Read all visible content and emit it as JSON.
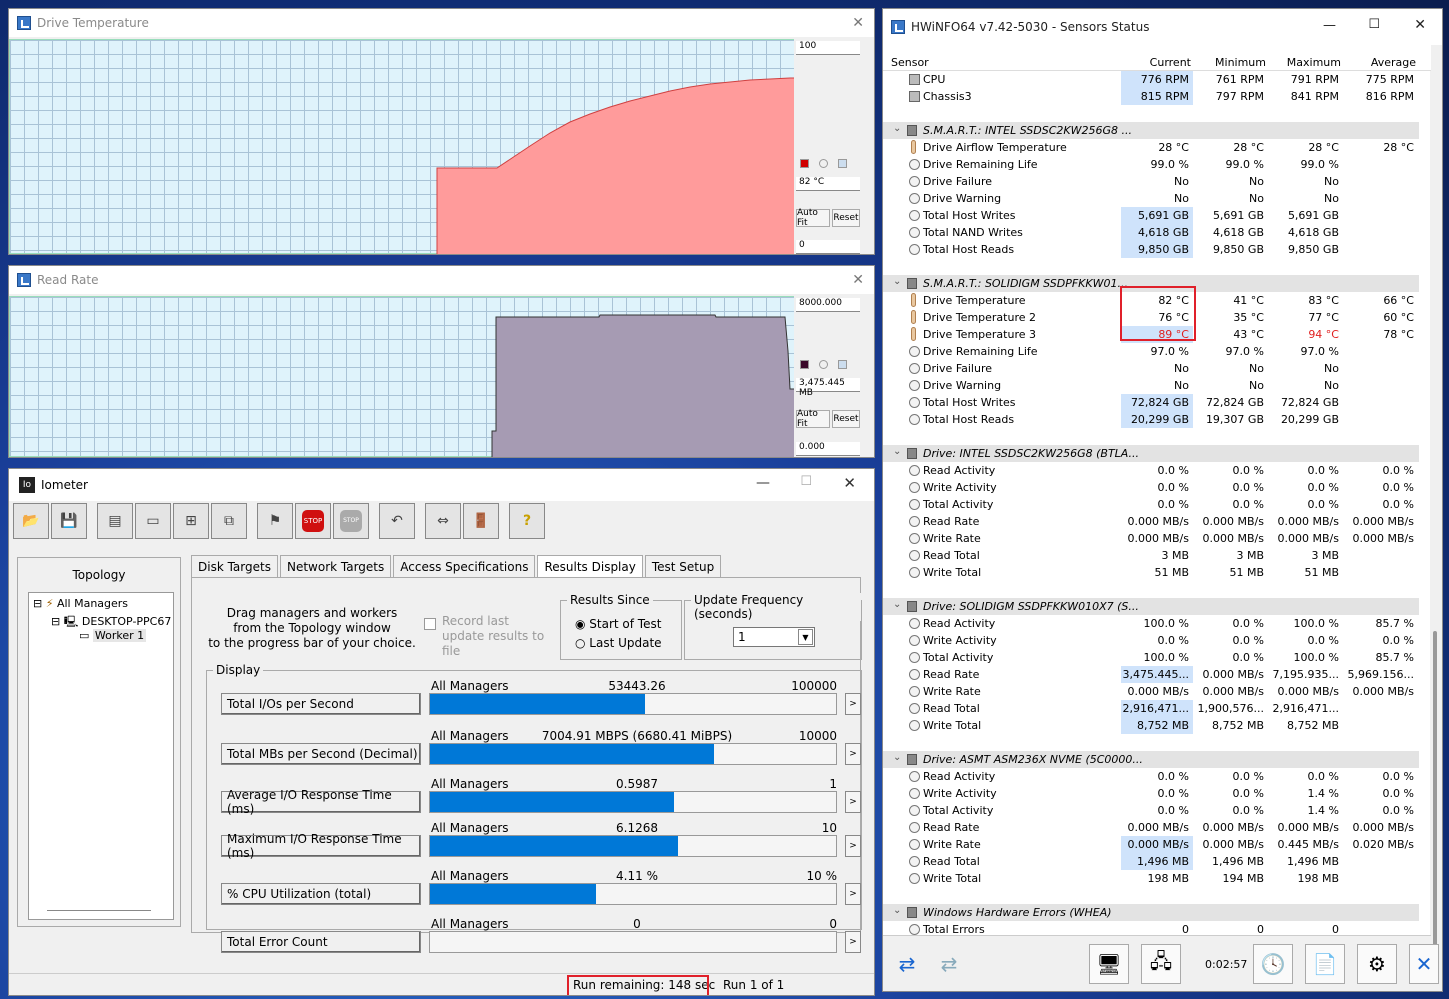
{
  "drive_temp": {
    "title": "Drive Temperature",
    "max": "100",
    "current": "82 °C",
    "min": "0",
    "autofit": "Auto Fit",
    "reset": "Reset",
    "fill_color": "#ff9b9b"
  },
  "read_rate": {
    "title": "Read Rate",
    "max": "8000.000",
    "current": "3,475.445 MB",
    "min": "0.000",
    "autofit": "Auto Fit",
    "reset": "Reset",
    "fill_color": "#a69bb3"
  },
  "iometer": {
    "title": "Iometer",
    "topology_label": "Topology",
    "tree": [
      "All Managers",
      "DESKTOP-PPC67",
      "Worker 1"
    ],
    "tabs": [
      "Disk Targets",
      "Network Targets",
      "Access Specifications",
      "Results Display",
      "Test Setup"
    ],
    "drag_text": [
      "Drag managers and workers",
      "from the Topology window",
      "to the progress bar of your choice."
    ],
    "record_label": "Record last update results to file",
    "results_since": {
      "label": "Results Since",
      "opt1": "Start of Test",
      "opt2": "Last Update"
    },
    "update_freq": {
      "label": "Update Frequency (seconds)",
      "value": "1"
    },
    "display_label": "Display",
    "metrics": [
      {
        "label": "Total I/Os per Second",
        "scope": "All Managers",
        "value": "53443.26",
        "max": "100000",
        "fraction": 0.53
      },
      {
        "label": "Total MBs per Second (Decimal)",
        "scope": "All Managers",
        "value": "7004.91 MBPS (6680.41 MiBPS)",
        "max": "10000",
        "fraction": 0.7
      },
      {
        "label": "Average I/O Response Time (ms)",
        "scope": "All Managers",
        "value": "0.5987",
        "max": "1",
        "fraction": 0.6
      },
      {
        "label": "Maximum I/O Response Time (ms)",
        "scope": "All Managers",
        "value": "6.1268",
        "max": "10",
        "fraction": 0.61
      },
      {
        "label": "% CPU Utilization (total)",
        "scope": "All Managers",
        "value": "4.11 %",
        "max": "10 %",
        "fraction": 0.41
      },
      {
        "label": "Total Error Count",
        "scope": "All Managers",
        "value": "0",
        "max": "0",
        "fraction": 0
      }
    ],
    "status_run_remaining": "Run remaining: 148 sec",
    "status_run": "Run 1 of 1"
  },
  "hwinfo": {
    "title": "HWiNFO64 v7.42-5030 - Sensors Status",
    "headers": [
      "Sensor",
      "Current",
      "Minimum",
      "Maximum",
      "Average"
    ],
    "rows": [
      {
        "t": "fan",
        "n": "CPU",
        "c": [
          "776 RPM",
          "761 RPM",
          "791 RPM",
          "775 RPM"
        ],
        "hl": true
      },
      {
        "t": "fan",
        "n": "Chassis3",
        "c": [
          "815 RPM",
          "797 RPM",
          "841 RPM",
          "816 RPM"
        ],
        "hl": true
      },
      {
        "t": "blank"
      },
      {
        "t": "group",
        "n": "S.M.A.R.T.: INTEL SSDSC2KW256G8 ..."
      },
      {
        "t": "temp",
        "n": "Drive Airflow Temperature",
        "c": [
          "28 °C",
          "28 °C",
          "28 °C",
          "28 °C"
        ]
      },
      {
        "t": "s",
        "n": "Drive Remaining Life",
        "c": [
          "99.0 %",
          "99.0 %",
          "99.0 %",
          ""
        ]
      },
      {
        "t": "s",
        "n": "Drive Failure",
        "c": [
          "No",
          "No",
          "No",
          ""
        ]
      },
      {
        "t": "s",
        "n": "Drive Warning",
        "c": [
          "No",
          "No",
          "No",
          ""
        ]
      },
      {
        "t": "s",
        "n": "Total Host Writes",
        "c": [
          "5,691 GB",
          "5,691 GB",
          "5,691 GB",
          ""
        ],
        "hl": true
      },
      {
        "t": "s",
        "n": "Total NAND Writes",
        "c": [
          "4,618 GB",
          "4,618 GB",
          "4,618 GB",
          ""
        ],
        "hl": true
      },
      {
        "t": "s",
        "n": "Total Host Reads",
        "c": [
          "9,850 GB",
          "9,850 GB",
          "9,850 GB",
          ""
        ],
        "hl": true
      },
      {
        "t": "blank"
      },
      {
        "t": "group",
        "n": "S.M.A.R.T.: SOLIDIGM SSDPFKKW01..."
      },
      {
        "t": "temp",
        "n": "Drive Temperature",
        "c": [
          "82 °C",
          "41 °C",
          "83 °C",
          "66 °C"
        ]
      },
      {
        "t": "temp",
        "n": "Drive Temperature 2",
        "c": [
          "76 °C",
          "35 °C",
          "77 °C",
          "60 °C"
        ]
      },
      {
        "t": "temp",
        "n": "Drive Temperature 3",
        "c": [
          "89 °C",
          "43 °C",
          "94 °C",
          "78 °C"
        ],
        "red": true,
        "hl": true
      },
      {
        "t": "s",
        "n": "Drive Remaining Life",
        "c": [
          "97.0 %",
          "97.0 %",
          "97.0 %",
          ""
        ]
      },
      {
        "t": "s",
        "n": "Drive Failure",
        "c": [
          "No",
          "No",
          "No",
          ""
        ]
      },
      {
        "t": "s",
        "n": "Drive Warning",
        "c": [
          "No",
          "No",
          "No",
          ""
        ]
      },
      {
        "t": "s",
        "n": "Total Host Writes",
        "c": [
          "72,824 GB",
          "72,824 GB",
          "72,824 GB",
          ""
        ],
        "hl": true
      },
      {
        "t": "s",
        "n": "Total Host Reads",
        "c": [
          "20,299 GB",
          "19,307 GB",
          "20,299 GB",
          ""
        ],
        "hl": true
      },
      {
        "t": "blank"
      },
      {
        "t": "group",
        "n": "Drive: INTEL SSDSC2KW256G8 (BTLA..."
      },
      {
        "t": "s",
        "n": "Read Activity",
        "c": [
          "0.0 %",
          "0.0 %",
          "0.0 %",
          "0.0 %"
        ]
      },
      {
        "t": "s",
        "n": "Write Activity",
        "c": [
          "0.0 %",
          "0.0 %",
          "0.0 %",
          "0.0 %"
        ]
      },
      {
        "t": "s",
        "n": "Total Activity",
        "c": [
          "0.0 %",
          "0.0 %",
          "0.0 %",
          "0.0 %"
        ]
      },
      {
        "t": "s",
        "n": "Read Rate",
        "c": [
          "0.000 MB/s",
          "0.000 MB/s",
          "0.000 MB/s",
          "0.000 MB/s"
        ]
      },
      {
        "t": "s",
        "n": "Write Rate",
        "c": [
          "0.000 MB/s",
          "0.000 MB/s",
          "0.000 MB/s",
          "0.000 MB/s"
        ]
      },
      {
        "t": "s",
        "n": "Read Total",
        "c": [
          "3 MB",
          "3 MB",
          "3 MB",
          ""
        ]
      },
      {
        "t": "s",
        "n": "Write Total",
        "c": [
          "51 MB",
          "51 MB",
          "51 MB",
          ""
        ]
      },
      {
        "t": "blank"
      },
      {
        "t": "group",
        "n": "Drive: SOLIDIGM SSDPFKKW010X7 (S..."
      },
      {
        "t": "s",
        "n": "Read Activity",
        "c": [
          "100.0 %",
          "0.0 %",
          "100.0 %",
          "85.7 %"
        ]
      },
      {
        "t": "s",
        "n": "Write Activity",
        "c": [
          "0.0 %",
          "0.0 %",
          "0.0 %",
          "0.0 %"
        ]
      },
      {
        "t": "s",
        "n": "Total Activity",
        "c": [
          "100.0 %",
          "0.0 %",
          "100.0 %",
          "85.7 %"
        ]
      },
      {
        "t": "s",
        "n": "Read Rate",
        "c": [
          "3,475.445...",
          "0.000 MB/s",
          "7,195.935...",
          "5,969.156..."
        ],
        "hl": true
      },
      {
        "t": "s",
        "n": "Write Rate",
        "c": [
          "0.000 MB/s",
          "0.000 MB/s",
          "0.000 MB/s",
          "0.000 MB/s"
        ]
      },
      {
        "t": "s",
        "n": "Read Total",
        "c": [
          "2,916,471...",
          "1,900,576...",
          "2,916,471...",
          ""
        ],
        "hl": true
      },
      {
        "t": "s",
        "n": "Write Total",
        "c": [
          "8,752 MB",
          "8,752 MB",
          "8,752 MB",
          ""
        ],
        "hl": true
      },
      {
        "t": "blank"
      },
      {
        "t": "group",
        "n": "Drive: ASMT ASM236X NVME (5C0000..."
      },
      {
        "t": "s",
        "n": "Read Activity",
        "c": [
          "0.0 %",
          "0.0 %",
          "0.0 %",
          "0.0 %"
        ]
      },
      {
        "t": "s",
        "n": "Write Activity",
        "c": [
          "0.0 %",
          "0.0 %",
          "1.4 %",
          "0.0 %"
        ]
      },
      {
        "t": "s",
        "n": "Total Activity",
        "c": [
          "0.0 %",
          "0.0 %",
          "1.4 %",
          "0.0 %"
        ]
      },
      {
        "t": "s",
        "n": "Read Rate",
        "c": [
          "0.000 MB/s",
          "0.000 MB/s",
          "0.000 MB/s",
          "0.000 MB/s"
        ]
      },
      {
        "t": "s",
        "n": "Write Rate",
        "c": [
          "0.000 MB/s",
          "0.000 MB/s",
          "0.445 MB/s",
          "0.020 MB/s"
        ],
        "hl": true
      },
      {
        "t": "s",
        "n": "Read Total",
        "c": [
          "1,496 MB",
          "1,496 MB",
          "1,496 MB",
          ""
        ],
        "hl": true
      },
      {
        "t": "s",
        "n": "Write Total",
        "c": [
          "198 MB",
          "194 MB",
          "198 MB",
          ""
        ]
      },
      {
        "t": "blank"
      },
      {
        "t": "group",
        "n": "Windows Hardware Errors (WHEA)"
      },
      {
        "t": "s",
        "n": "Total Errors",
        "c": [
          "0",
          "0",
          "0",
          ""
        ]
      }
    ],
    "elapsed": "0:02:57"
  }
}
